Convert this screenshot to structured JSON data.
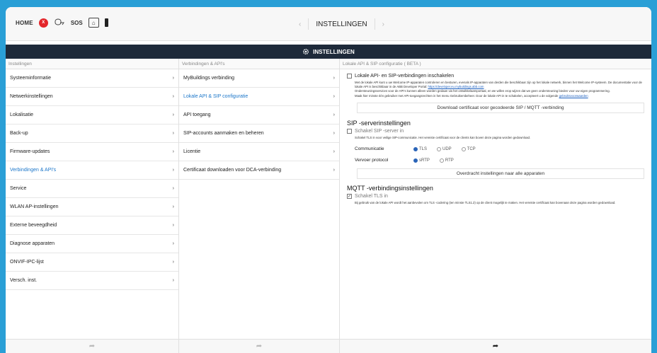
{
  "topbar": {
    "home_label": "HOME",
    "stop_glyph": "X",
    "sos_label": "SOS",
    "house_glyph": "⌂",
    "prev_arrow": "‹",
    "next_arrow": "›",
    "title": "INSTELLINGEN"
  },
  "header": {
    "title": "INSTELLINGEN"
  },
  "col1": {
    "heading": "Instellingen",
    "items": [
      {
        "label": "Systeeminformatie",
        "chev": "›"
      },
      {
        "label": "Netwerkinstellingen",
        "chev": "›"
      },
      {
        "label": "Lokalisatie",
        "chev": "›"
      },
      {
        "label": "Back-up",
        "chev": "›"
      },
      {
        "label": "Firmware-updates",
        "chev": "›"
      },
      {
        "label": "Verbindingen & API's",
        "chev": "›"
      },
      {
        "label": "Service",
        "chev": "›"
      },
      {
        "label": "WLAN AP-instellingen",
        "chev": "›"
      },
      {
        "label": "Externe beveegdheid",
        "chev": "›"
      },
      {
        "label": "Diagnose apparaten",
        "chev": "›"
      },
      {
        "label": "ONVIF-IPC-lijst",
        "chev": "›"
      },
      {
        "label": "Versch. inst.",
        "chev": "›"
      }
    ],
    "back_glyph": "➦"
  },
  "col2": {
    "heading": "Verbindingen & API's",
    "items": [
      {
        "label": "MyBuildings verbinding",
        "chev": "›"
      },
      {
        "label": "Lokale API & SIP configuratie",
        "chev": "›"
      },
      {
        "label": "API toegang",
        "chev": "›"
      },
      {
        "label": "SIP-accounts aanmaken en beheren",
        "chev": "›"
      },
      {
        "label": "Licentie",
        "chev": "›"
      },
      {
        "label": "Certificaat downloaden voor DCA-verbinding",
        "chev": "›"
      }
    ],
    "back_glyph": "➦"
  },
  "col3": {
    "heading": "Lokale API & SIP configuratie ( BETA )",
    "enable_label": "Lokale API- en SIP-verbindingen inschakelen",
    "enable_desc1": "Met de lokale API kunt u uw Welcome IP-apparaten controleren en besturen, evenals IP-apparaten van derden die beschikbaar zijn op het lokale netwerk, binnen het Welcome IP-systeem. De documentatie voor de lokale API is beschikbaar in de ABB Developer Portal:",
    "enable_link": "https://developer.eu.mybuildings.abb.com",
    "enable_desc2": "Ondersteuningsservices voor de API's kunnen alleen worden gedaan via het ontwikkelaarsportaal, en we willen erop wijzen dat we geen ondersteuning bieden voor uw eigen programmering.",
    "enable_desc3": "Maak hier minste één gebruiker met API-toegangsrechten in het menu Gebruikersbeheer. Door de lokale API in te schakelen, accepteert u de volgende",
    "terms_link": "gebruiksvoorwaarden",
    "download_button": "Download certificaat voor gecodeerde SIP / MQTT -verbinding",
    "sip_section": "SIP -serverinstellingen",
    "sip_tls_label": "Schakel SIP -server in",
    "sip_tls_desc": "Schakel TLS in voor veilige SIP-communicatie. Het vereiste certificaat voor de clients kan boven deze pagina worden gedownload.",
    "comm_label": "Communicatie",
    "comm_options": [
      "TLS",
      "UDP",
      "TCP"
    ],
    "transport_label": "Vervoer protocol",
    "transport_options": [
      "sRTP",
      "RTP"
    ],
    "transfer_button": "Overdracht instellingen naar alle apparaten",
    "mqtt_section": "MQTT -verbindingsinstellingen",
    "mqtt_tls_label": "Schakel TLS in",
    "mqtt_tls_check": "✓",
    "mqtt_desc": "Bij gebruik van de lokale API wordt het aanbevolen om TLS -codering (ten minste TLS1.2) op de client mogelijk te maken. Het vereiste certificaat kan bovenaan deze pagina worden gedownload.",
    "back_glyph": "➦"
  }
}
